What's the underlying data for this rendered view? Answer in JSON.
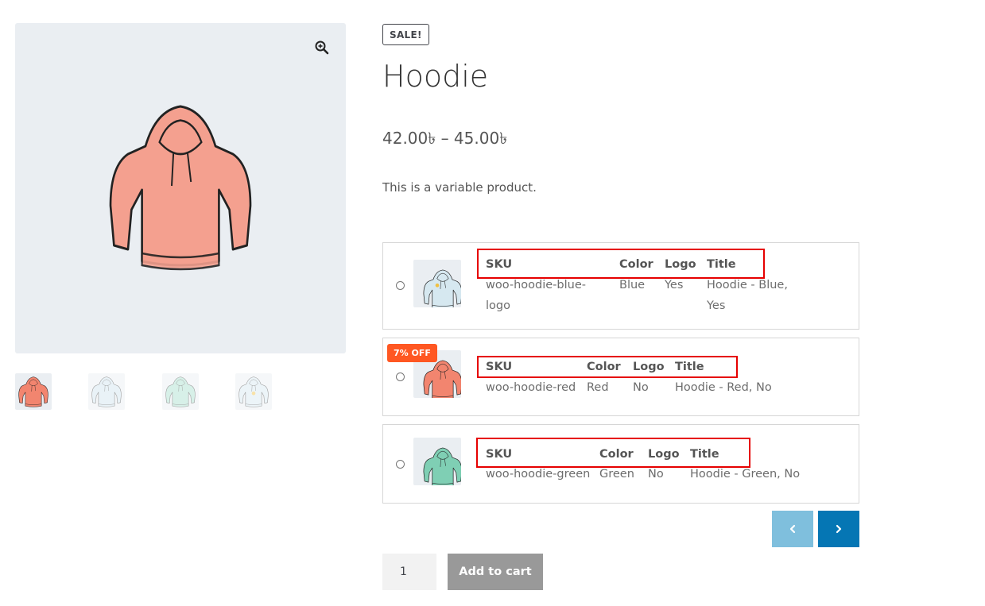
{
  "product": {
    "sale_badge": "SALE!",
    "title": "Hoodie",
    "price": "42.00৳ – 45.00৳",
    "description": "This is a variable product."
  },
  "gallery": {
    "main_icon": "hoodie-red-image",
    "zoom_icon": "zoom-in-icon",
    "thumbnails": [
      "hoodie-red",
      "hoodie-blue",
      "hoodie-green",
      "hoodie-blue-logo"
    ]
  },
  "variations": {
    "headers": {
      "sku": "SKU",
      "color": "Color",
      "logo": "Logo",
      "title": "Title"
    },
    "rows": [
      {
        "sku": "woo-hoodie-blue-logo",
        "sku_line1": "woo-hoodie-blue-",
        "sku_line2": "logo",
        "color": "Blue",
        "logo": "Yes",
        "title": "Hoodie - Blue, Yes",
        "title_line1": "Hoodie - Blue,",
        "title_line2": "Yes",
        "badge": ""
      },
      {
        "sku": "woo-hoodie-red",
        "color": "Red",
        "logo": "No",
        "title": "Hoodie - Red, No",
        "badge": "7% OFF"
      },
      {
        "sku": "woo-hoodie-green",
        "color": "Green",
        "logo": "No",
        "title": "Hoodie - Green, No",
        "badge": ""
      }
    ]
  },
  "pagination": {
    "prev_icon": "chevron-left-icon",
    "next_icon": "chevron-right-icon"
  },
  "cart": {
    "quantity": "1",
    "button_label": "Add to cart"
  },
  "colors": {
    "accent": "#0576b4",
    "accent_light": "#7fbfdd",
    "badge": "#ff5722",
    "highlight": "#e60000",
    "button_disabled": "#999999"
  }
}
